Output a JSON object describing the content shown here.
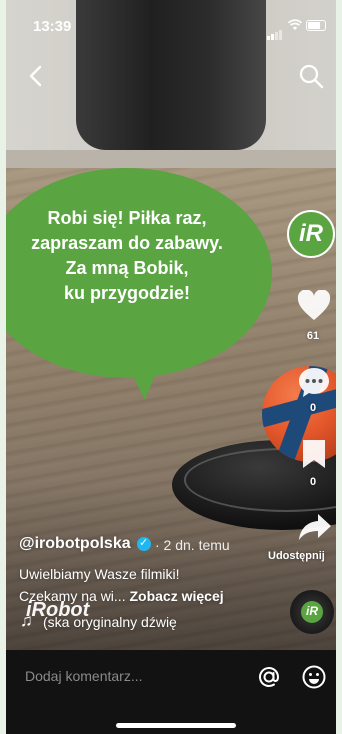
{
  "status_bar": {
    "time": "13:39"
  },
  "overlay": {
    "speech_lines": [
      "Robi się! Piłka raz,",
      "zapraszam do zabawy.",
      "Za mną Bobik,",
      "ku przygodzie!"
    ]
  },
  "rail": {
    "avatar_letter": "iR",
    "like_count": "61",
    "comment_count": "0",
    "save_count": "0",
    "share_label": "Udostępnij",
    "disc_letter": "iR"
  },
  "caption": {
    "author": "@irobotpolska",
    "age": "· 2 dn. temu",
    "line1": "Uwielbiamy Wasze filmiki!",
    "line2": "Czekamy na wi...",
    "more": "Zobacz więcej",
    "music": "(ska   oryginalny dźwię",
    "watermark": "iRobot"
  },
  "comment_bar": {
    "placeholder": "Dodaj komentarz..."
  },
  "colors": {
    "brand_green": "#5aa442",
    "verified_blue": "#20b7f0"
  }
}
